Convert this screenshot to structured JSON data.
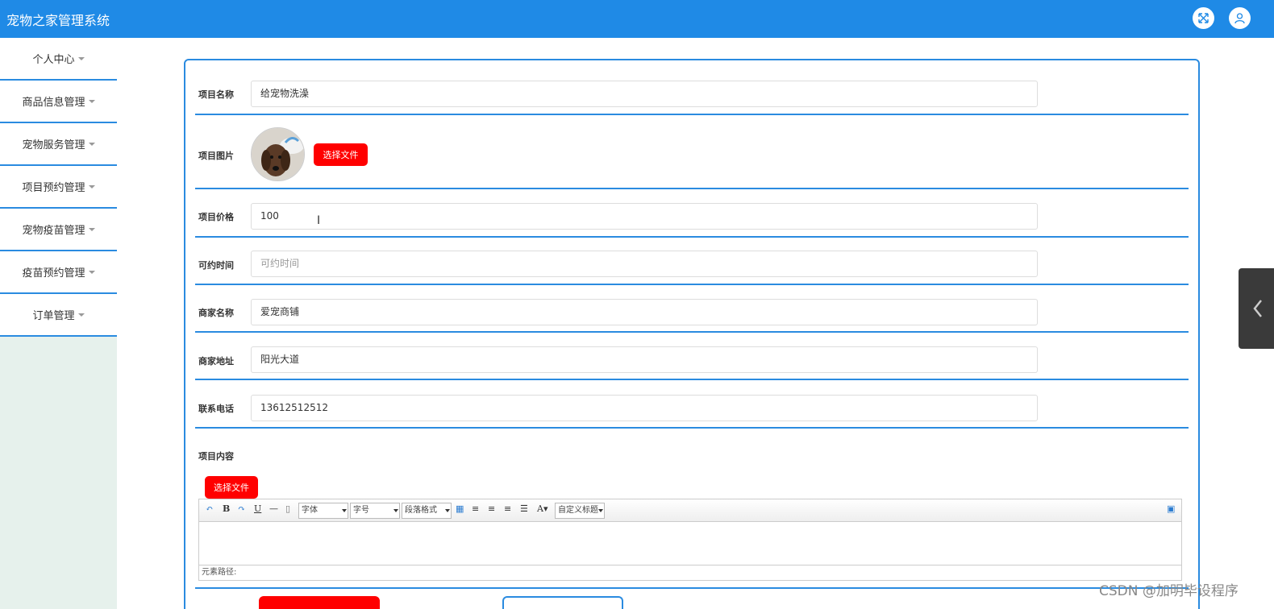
{
  "header": {
    "title": "宠物之家管理系统"
  },
  "sidebar": {
    "items": [
      {
        "label": "个人中心"
      },
      {
        "label": "商品信息管理"
      },
      {
        "label": "宠物服务管理"
      },
      {
        "label": "项目预约管理"
      },
      {
        "label": "宠物疫苗管理"
      },
      {
        "label": "疫苗预约管理"
      },
      {
        "label": "订单管理"
      }
    ]
  },
  "form": {
    "name_label": "项目名称",
    "name_value": "给宠物洗澡",
    "image_label": "项目图片",
    "image_button": "选择文件",
    "price_label": "项目价格",
    "price_value": "100",
    "time_label": "可约时间",
    "time_placeholder": "可约时间",
    "shop_label": "商家名称",
    "shop_value": "爱宠商铺",
    "address_label": "商家地址",
    "address_value": "阳光大道",
    "phone_label": "联系电话",
    "phone_value": "13612512512",
    "content_label": "项目内容",
    "content_button": "选择文件"
  },
  "editor": {
    "font_select": "字体",
    "size_select": "字号",
    "paragraph_select": "段落格式",
    "custom_title_select": "自定义标题",
    "status_path": "元素路径:"
  },
  "watermark": "CSDN @加明毕设程序",
  "colors": {
    "header": "#1f8ae6",
    "accent": "#2a8be0",
    "button": "#ff0000",
    "sidebar_bg": "#e6f1ec"
  }
}
